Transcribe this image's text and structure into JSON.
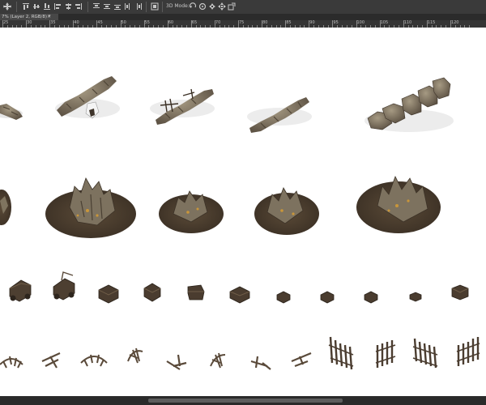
{
  "document_tab": {
    "title": "7% (Layer 2, RGB/8) *",
    "close_glyph": "×"
  },
  "options_bar": {
    "mode_label": "3D Mode:"
  },
  "ruler": {
    "labels": [
      "25",
      "30",
      "35",
      "40",
      "45",
      "50",
      "55",
      "60",
      "65",
      "70",
      "75",
      "80",
      "85",
      "90",
      "95",
      "100",
      "105",
      "110",
      "115",
      "120"
    ]
  },
  "colors": {
    "stone": "#8d8069",
    "stone_dark": "#5f5444",
    "dirt": "#4a3d2e",
    "gold": "#b8862e",
    "wood": "#6b5a45",
    "wood_dark": "#3e3328",
    "shadow": "#dcdcdc"
  }
}
